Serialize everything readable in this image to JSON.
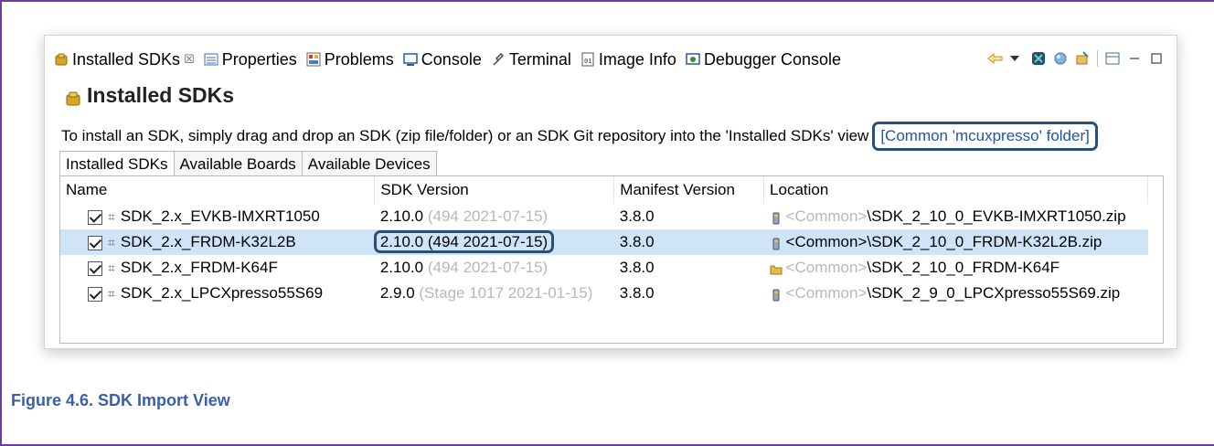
{
  "view_tabs": [
    {
      "label": "Installed SDKs",
      "icon": "sdk-icon",
      "closable": true
    },
    {
      "label": "Properties",
      "icon": "properties-icon"
    },
    {
      "label": "Problems",
      "icon": "problems-icon"
    },
    {
      "label": "Console",
      "icon": "console-icon"
    },
    {
      "label": "Terminal",
      "icon": "terminal-icon"
    },
    {
      "label": "Image Info",
      "icon": "image-info-icon"
    },
    {
      "label": "Debugger Console",
      "icon": "debugger-console-icon"
    }
  ],
  "close_glyph": "☒",
  "panel_title": "Installed SDKs",
  "instruction": "To install an SDK, simply drag and drop an SDK (zip file/folder) or an SDK Git repository into the 'Installed SDKs' view",
  "common_folder_link": "[Common 'mcuxpresso' folder]",
  "inner_tabs": [
    "Installed SDKs",
    "Available Boards",
    "Available Devices"
  ],
  "columns": [
    "Name",
    "SDK Version",
    "Manifest Version",
    "Location"
  ],
  "rows": [
    {
      "name": "SDK_2.x_EVKB-IMXRT1050",
      "version": "2.10.0",
      "version_detail": "(494 2021-07-15)",
      "manifest": "3.8.0",
      "loc_prefix": "<Common>",
      "loc_path": "\\SDK_2_10_0_EVKB-IMXRT1050.zip",
      "loc_icon": "zip-icon",
      "selected": false
    },
    {
      "name": "SDK_2.x_FRDM-K32L2B",
      "version": "2.10.0",
      "version_detail": "(494 2021-07-15)",
      "manifest": "3.8.0",
      "loc_prefix": "<Common>",
      "loc_path": "\\SDK_2_10_0_FRDM-K32L2B.zip",
      "loc_icon": "zip-icon",
      "selected": true
    },
    {
      "name": "SDK_2.x_FRDM-K64F",
      "version": "2.10.0",
      "version_detail": "(494 2021-07-15)",
      "manifest": "3.8.0",
      "loc_prefix": "<Common>",
      "loc_path": "\\SDK_2_10_0_FRDM-K64F",
      "loc_icon": "folder-icon",
      "selected": false
    },
    {
      "name": "SDK_2.x_LPCXpresso55S69",
      "version": "2.9.0",
      "version_detail": "(Stage 1017 2021-01-15)",
      "manifest": "3.8.0",
      "loc_prefix": "<Common>",
      "loc_path": "\\SDK_2_9_0_LPCXpresso55S69.zip",
      "loc_icon": "zip-icon",
      "selected": false
    }
  ],
  "caption": "Figure 4.6. SDK Import View",
  "colors": {
    "accent_border": "#2c4f75",
    "selection": "#cfe5f7",
    "caption": "#3a5fa8",
    "link": "#1a57b0"
  }
}
